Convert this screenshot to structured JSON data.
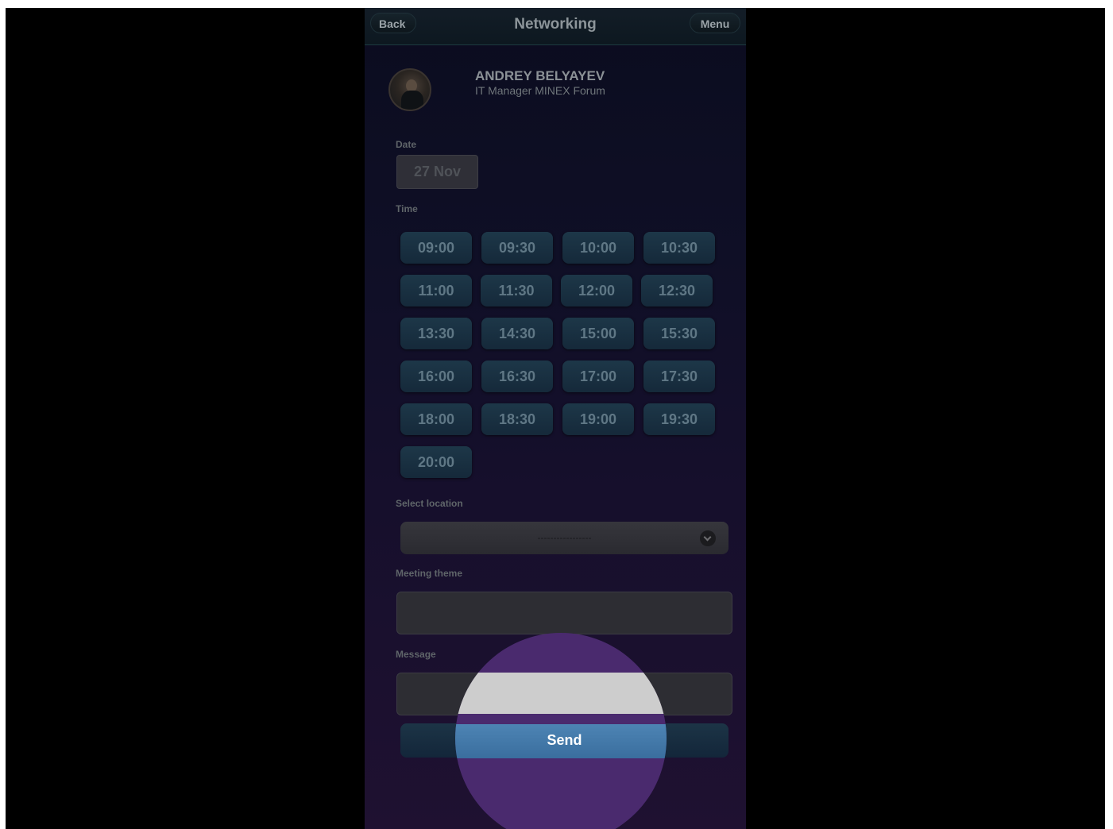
{
  "header": {
    "back_label": "Back",
    "title": "Networking",
    "menu_label": "Menu"
  },
  "profile": {
    "name": "ANDREY BELYAYEV",
    "position": "IT Manager MINEX Forum"
  },
  "date": {
    "label": "Date",
    "value": "27 Nov"
  },
  "time": {
    "label": "Time",
    "slots": [
      "09:00",
      "09:30",
      "10:00",
      "10:30",
      "11:00",
      "11:30",
      "12:00",
      "12:30",
      "13:30",
      "14:30",
      "15:00",
      "15:30",
      "16:00",
      "16:30",
      "17:00",
      "17:30",
      "18:00",
      "18:30",
      "19:00",
      "19:30",
      "20:00"
    ]
  },
  "location": {
    "label": "Select location",
    "value": "-----------------"
  },
  "theme": {
    "label": "Meeting theme",
    "value": ""
  },
  "message": {
    "label": "Message",
    "value": ""
  },
  "send_label": "Send",
  "icons": {
    "select": "chevron-down-icon",
    "avatar": "user-photo"
  },
  "colors": {
    "send_active": "#4d84b4",
    "touch_overlay": "#4a2a6e"
  }
}
